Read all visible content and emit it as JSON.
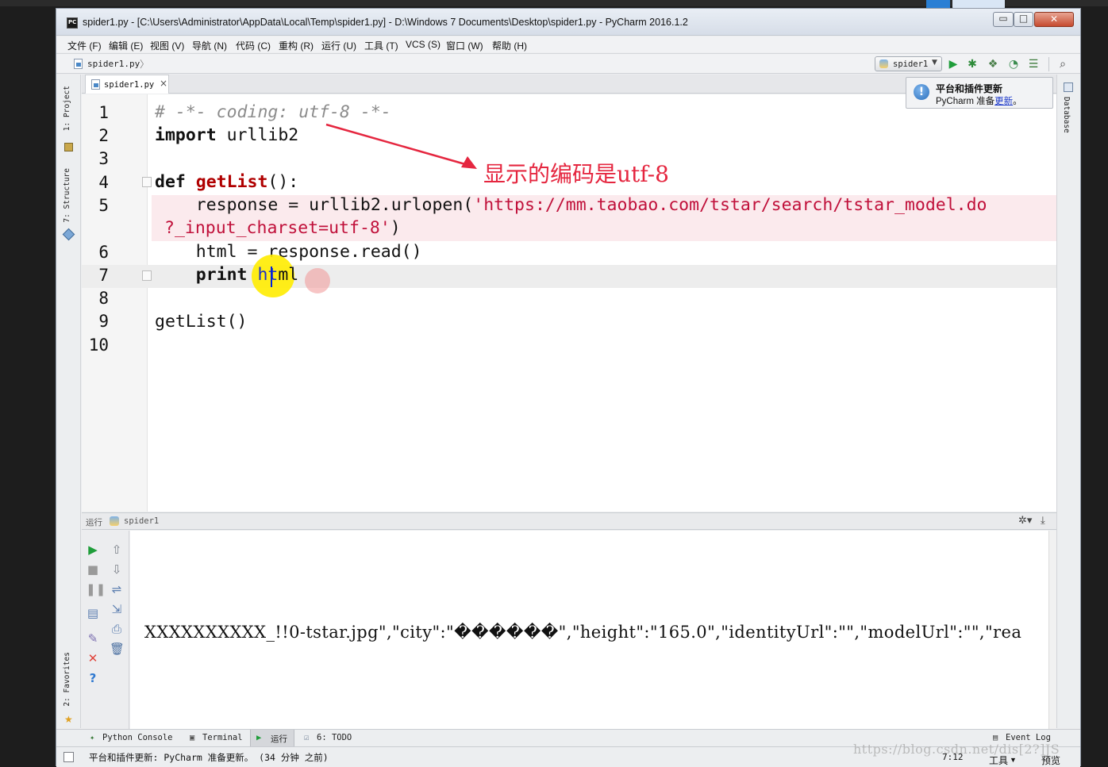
{
  "window": {
    "title": "spider1.py - [C:\\Users\\Administrator\\AppData\\Local\\Temp\\spider1.py] - D:\\Windows 7 Documents\\Desktop\\spider1.py - PyCharm 2016.1.2",
    "min": "▭",
    "max": "□",
    "close": "✕"
  },
  "menu": {
    "items": [
      "文件 (F)",
      "编辑 (E)",
      "视图 (V)",
      "导航 (N)",
      "代码 (C)",
      "重构 (R)",
      "运行 (U)",
      "工具 (T)",
      "VCS (S)",
      "窗口 (W)",
      "帮助 (H)"
    ]
  },
  "navbar": {
    "breadcrumb_file": "spider1.py",
    "breadcrumb_sep": "〉",
    "run_config": "spider1",
    "icons": [
      "run-icon",
      "debug-icon",
      "coverage-icon",
      "profile-icon",
      "concurrency-icon",
      "search-icon"
    ]
  },
  "sidebars": {
    "left_tabs": [
      "1: Project",
      "7: Structure",
      "2: Favorites"
    ],
    "right_tabs": [
      "Database"
    ]
  },
  "editor": {
    "tab_label": "spider1.py",
    "tab_close": "×",
    "line_numbers": [
      "1",
      "2",
      "3",
      "4",
      "5",
      "6",
      "7",
      "8",
      "9",
      "10"
    ],
    "code": {
      "l1": "# -*- coding: utf-8 -*-",
      "l2_kw": "import",
      "l2_rest": " urllib2",
      "l4_kw": "def",
      "l4_fn": "getList",
      "l4_rest": "():",
      "l5_pre": "    response = urllib2.urlopen(",
      "l5_str": "'https://mm.taobao.com/tstar/search/tstar_model.do",
      "l5_cont_str": "?_input_charset=utf-8'",
      "l5_cont_end": ")",
      "l6": "    html = response.read()",
      "l7_kw": "    print",
      "l7_a": "h",
      "l7_b": "t",
      "l7_c": "ml",
      "l9": "getList()"
    },
    "annotation": "显示的编码是utf-8"
  },
  "notification": {
    "title": "平台和插件更新",
    "body_prefix": "PyCharm 准备",
    "body_link": "更新",
    "body_suffix": "。",
    "icon_glyph": "!"
  },
  "run_panel": {
    "label": "运行",
    "config": "spider1",
    "gear": "✲▾",
    "pin": "⤓",
    "output": "XXXXXXXXXX_!!0-tstar.jpg\",\"city\":\"������\",\"height\":\"165.0\",\"identityUrl\":\"\",\"modelUrl\":\"\",\"rea"
  },
  "bottom_tabs": {
    "python_console": "Python Console",
    "terminal": "Terminal",
    "run": "运行",
    "todo": "6: TODO",
    "event_log": "Event Log"
  },
  "statusbar": {
    "message": "平台和插件更新: PyCharm 准备更新。 (34 分钟 之前)",
    "position": "7:12",
    "menu_tools": "工具",
    "menu_preview": "预览",
    "watermark": "https://blog.csdn.net/dis[2?]JS"
  },
  "colors": {
    "keyword": "#000080",
    "function": "#b00000",
    "string": "#c0103a",
    "annotation": "#e5263f",
    "run_green": "#2ea043"
  }
}
